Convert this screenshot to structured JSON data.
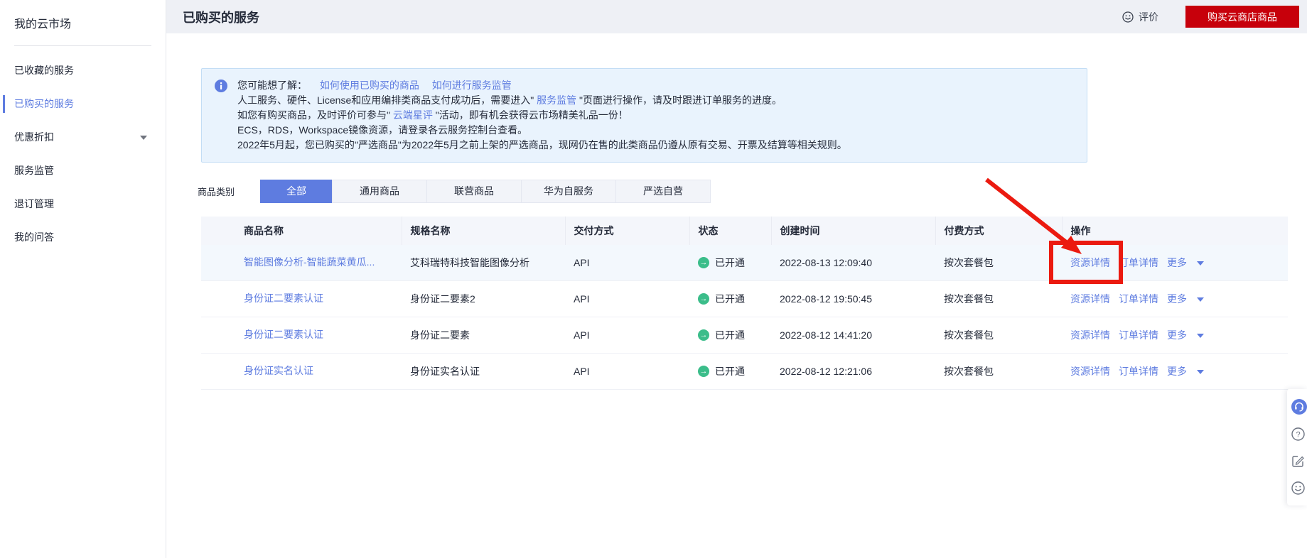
{
  "colors": {
    "accent_blue": "#5e7ce0",
    "brand_red": "#c7000b",
    "annotation_red": "#eb1a10",
    "success_green": "#3bbd8a",
    "banner_bg": "#e9f3fd",
    "banner_border": "#c3ddf5",
    "page_bg": "#eef0f5",
    "text_dark": "#252b3a",
    "text_gray": "#575d6c"
  },
  "sidebar": {
    "title": "我的云市场",
    "items": [
      {
        "label": "已收藏的服务"
      },
      {
        "label": "已购买的服务"
      },
      {
        "label": "优惠折扣"
      },
      {
        "label": "服务监管"
      },
      {
        "label": "退订管理"
      },
      {
        "label": "我的问答"
      }
    ]
  },
  "header": {
    "title": "已购买的服务",
    "review_label": "评价",
    "buy_button_label": "购买云商店商品"
  },
  "notice": {
    "line1_label": "您可能想了解：",
    "line1_link1": "如何使用已购买的商品",
    "line1_link2": "如何进行服务监管",
    "line2_pre": "人工服务、硬件、License和应用编排类商品支付成功后，需要进入\" ",
    "line2_link": "服务监管",
    "line2_post": " \"页面进行操作，请及时跟进订单服务的进度。",
    "line3_pre": "如您有购买商品，及时评价可参与\" ",
    "line3_link": "云端星评",
    "line3_post": " \"活动，即有机会获得云市场精美礼品一份！",
    "line4": "ECS，RDS，Workspace镜像资源，请登录各云服务控制台查看。",
    "line5": "2022年5月起，您已购买的\"严选商品\"为2022年5月之前上架的严选商品，现网仍在售的此类商品仍遵从原有交易、开票及结算等相关规则。"
  },
  "filter": {
    "label": "商品类别",
    "tabs": [
      {
        "label": "全部"
      },
      {
        "label": "通用商品"
      },
      {
        "label": "联营商品"
      },
      {
        "label": "华为自服务"
      },
      {
        "label": "严选自营"
      }
    ]
  },
  "table": {
    "columns": [
      "商品名称",
      "规格名称",
      "交付方式",
      "状态",
      "创建时间",
      "付费方式",
      "操作"
    ],
    "rows": [
      {
        "name": "智能图像分析-智能蔬菜黄瓜...",
        "spec": "艾科瑞特科技智能图像分析",
        "delivery": "API",
        "status": "已开通",
        "created": "2022-08-13 12:09:40",
        "payment": "按次套餐包",
        "action1": "资源详情",
        "action2": "订单详情",
        "action3": "更多"
      },
      {
        "name": "身份证二要素认证",
        "spec": "身份证二要素2",
        "delivery": "API",
        "status": "已开通",
        "created": "2022-08-12 19:50:45",
        "payment": "按次套餐包",
        "action1": "资源详情",
        "action2": "订单详情",
        "action3": "更多"
      },
      {
        "name": "身份证二要素认证",
        "spec": "身份证二要素",
        "delivery": "API",
        "status": "已开通",
        "created": "2022-08-12 14:41:20",
        "payment": "按次套餐包",
        "action1": "资源详情",
        "action2": "订单详情",
        "action3": "更多"
      },
      {
        "name": "身份证实名认证",
        "spec": "身份证实名认证",
        "delivery": "API",
        "status": "已开通",
        "created": "2022-08-12 12:21:06",
        "payment": "按次套餐包",
        "action1": "资源详情",
        "action2": "订单详情",
        "action3": "更多"
      }
    ]
  },
  "float_toolbar": {
    "icons": [
      "headset-support",
      "help-question",
      "feedback-edit",
      "smiley-review"
    ]
  }
}
